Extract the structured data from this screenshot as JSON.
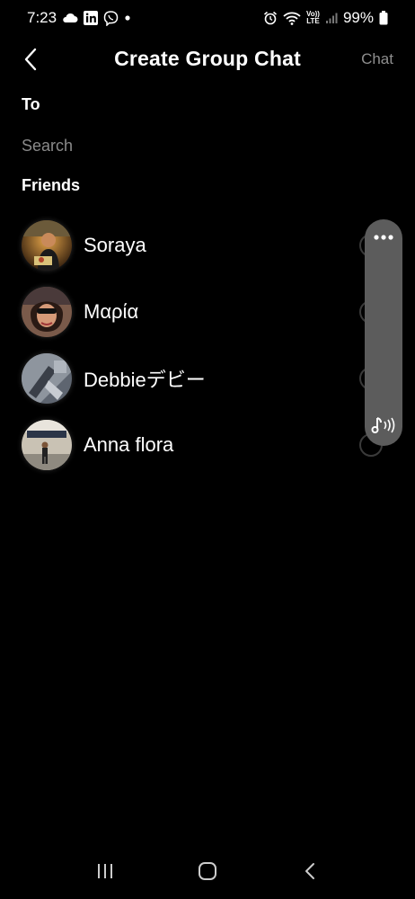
{
  "status_bar": {
    "time": "7:23",
    "battery": "99%",
    "icons_left": [
      "cloud-icon",
      "linkedin-icon",
      "viber-icon",
      "dot-icon"
    ],
    "icons_right": [
      "alarm-icon",
      "wifi-icon",
      "volte-icon",
      "signal-icon",
      "battery-icon"
    ],
    "volte_label_top": "Vo))",
    "volte_label_bottom": "LTE"
  },
  "header": {
    "title": "Create Group Chat",
    "action_label": "Chat",
    "action_color": "#8e8e8e"
  },
  "to_label": "To",
  "search": {
    "placeholder": "Search",
    "value": ""
  },
  "friends_label": "Friends",
  "friends": [
    {
      "name": "Soraya",
      "avatar": "avatar-photo"
    },
    {
      "name": "Μαρία",
      "avatar": "avatar-photo"
    },
    {
      "name": "Debbieデビー",
      "avatar": "avatar-photo"
    },
    {
      "name": "Anna flora",
      "avatar": "avatar-photo"
    }
  ],
  "side_panel": {
    "top_icon": "more-horizontal-icon",
    "bottom_icon": "audio-note-icon",
    "color": "#5c5c5c"
  },
  "nav_bar": {
    "icons": [
      "recent-apps-icon",
      "home-icon",
      "back-icon"
    ]
  },
  "colors": {
    "background": "#000000",
    "text": "#ffffff",
    "muted": "#8a8a8a"
  }
}
